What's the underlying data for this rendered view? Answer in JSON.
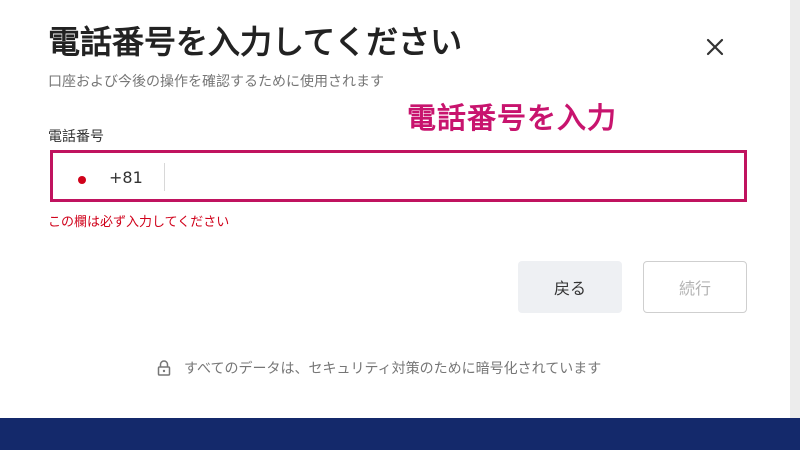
{
  "dialog": {
    "title": "電話番号を入力してください",
    "subtitle": "口座および今後の操作を確認するために使用されます",
    "close_icon": "close-icon"
  },
  "annotation": {
    "text": "電話番号を入力",
    "color": "#c8146e"
  },
  "phone_field": {
    "label": "電話番号",
    "country_icon": "japan-flag-dot",
    "dial_code": "+81",
    "value": "",
    "error": "この欄は必ず入力してください",
    "highlight_color": "#c0135f",
    "error_color": "#d0021b"
  },
  "buttons": {
    "back_label": "戻る",
    "next_label": "続行"
  },
  "footer": {
    "lock_icon": "lock-icon",
    "security_text": "すべてのデータは、セキュリティ対策のために暗号化されています"
  },
  "colors": {
    "bottom_bar": "#14296b"
  }
}
